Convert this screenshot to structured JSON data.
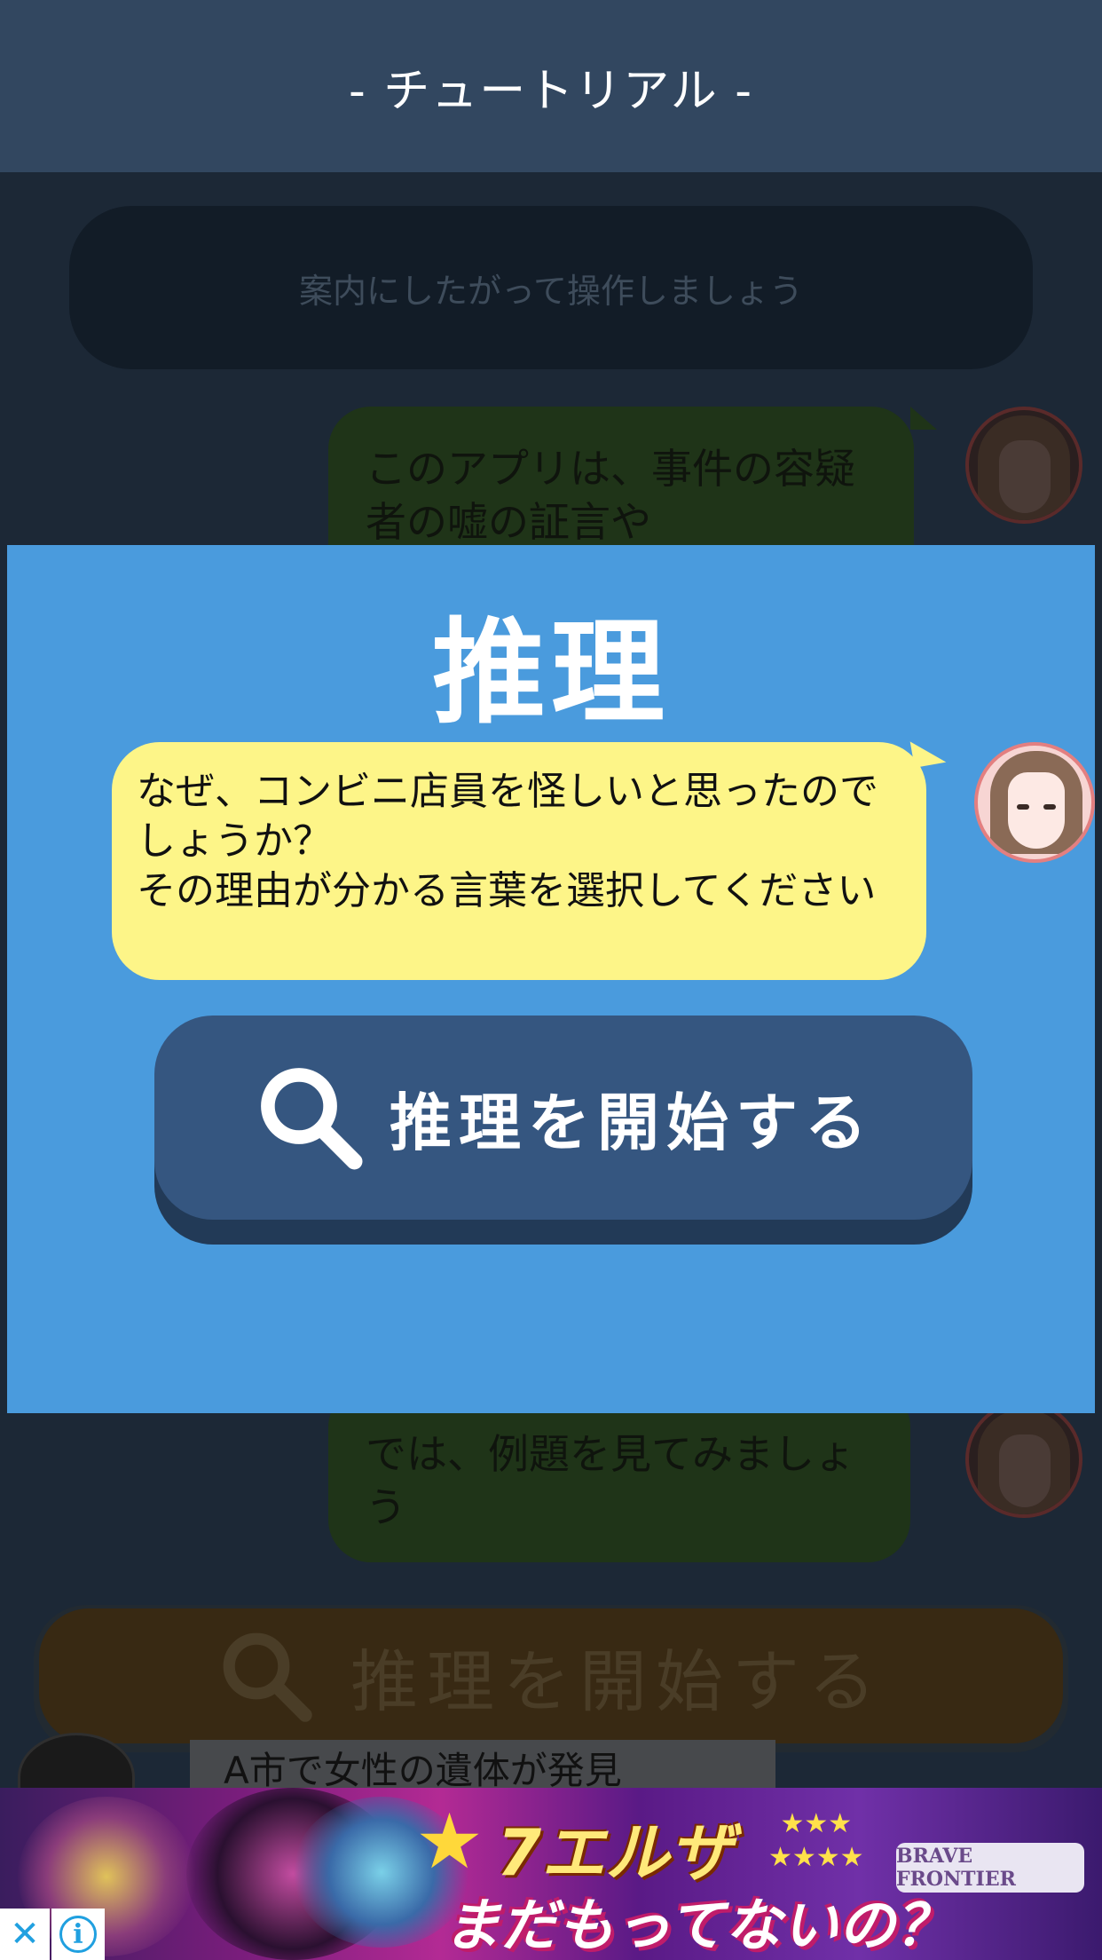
{
  "header": {
    "title": "- チュートリアル -"
  },
  "chat": {
    "system_message": "案内にしたがって操作しましょう",
    "message_top": "このアプリは、事件の容疑者の嘘の証言や",
    "message_bottom": "では、例題を見てみましょう",
    "background_button_label": "推理を開始する",
    "news_preview": "A市で女性の遺体が発見"
  },
  "modal": {
    "title": "推理",
    "prompt_line1": "なぜ、コンビニ店員を怪しいと思ったのでしょうか？",
    "prompt_line2": "その理由が分かる言葉を選択してください",
    "start_button_label": "推理を開始する",
    "start_icon": "magnifier-icon"
  },
  "ad": {
    "headline_star": "★",
    "headline": "7エルザ",
    "rating_stars_row1": "★★★",
    "rating_stars_row2": "★★★★",
    "subline": "まだもってないの？",
    "logo_text": "BRAVE FRONTIER",
    "close_icon": "close-icon",
    "info_icon": "info-icon"
  },
  "colors": {
    "header_bg": "#324760",
    "modal_bg": "#4a9bdd",
    "prompt_bubble": "#fdf588",
    "start_button": "#355680"
  }
}
